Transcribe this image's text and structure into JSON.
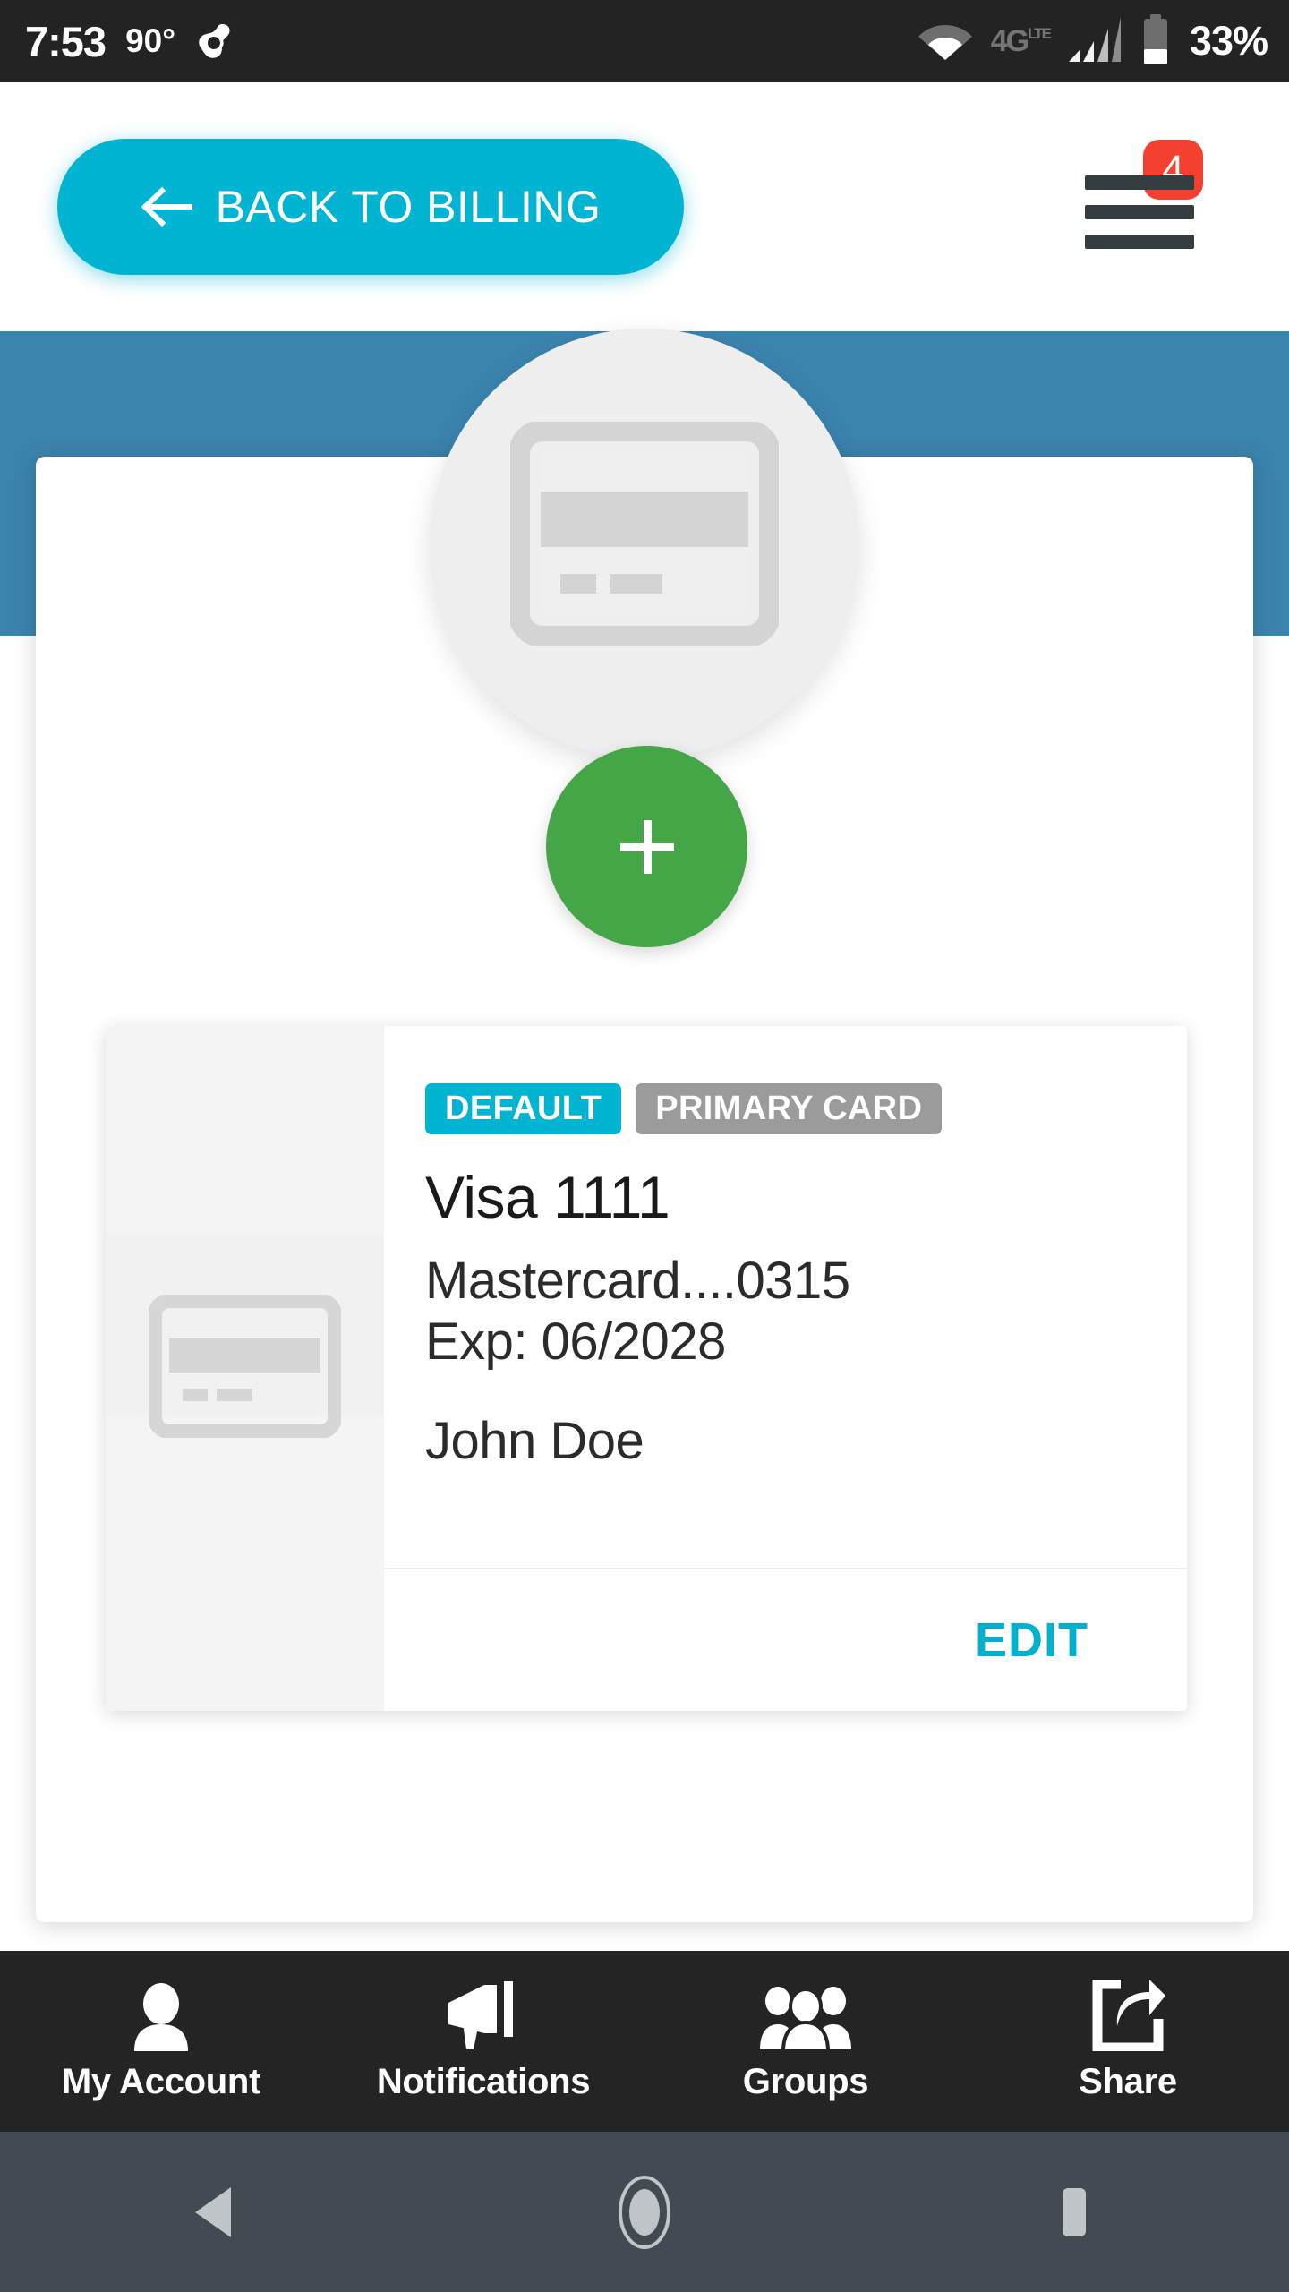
{
  "status_bar": {
    "time": "7:53",
    "temperature": "90°",
    "app_icon": "avast-shield-icon",
    "wifi_icon": "wifi-icon",
    "network_label": "4G",
    "network_sup": "LTE",
    "signal_icon": "cellular-signal-icon",
    "battery_icon": "battery-icon",
    "battery_text": "33%",
    "background": "#232323"
  },
  "header": {
    "back_button_label": "BACK TO BILLING",
    "back_icon": "arrow-left-icon",
    "menu_icon": "hamburger-menu-icon",
    "menu_badge_count": "4",
    "accent_color": "#00b4d2",
    "badge_color": "#f4402e"
  },
  "banner": {
    "background": "#3b84ae",
    "avatar_icon": "credit-card-icon"
  },
  "add_button": {
    "icon": "plus-icon",
    "label": "",
    "color": "#45a648"
  },
  "payment_method": {
    "thumbnail_icon": "credit-card-icon",
    "badges": [
      {
        "label": "DEFAULT",
        "color": "#00b4d2"
      },
      {
        "label": "PRIMARY CARD",
        "color": "#9b9b9b"
      }
    ],
    "title": "Visa 1111",
    "number_line": "Mastercard....0315",
    "expiry_line": "Exp: 06/2028",
    "cardholder": "John Doe",
    "edit_label": "EDIT",
    "edit_color": "#00b0cd"
  },
  "tab_bar": {
    "background": "#242424",
    "items": [
      {
        "label": "My Account",
        "icon": "person-icon"
      },
      {
        "label": "Notifications",
        "icon": "megaphone-icon"
      },
      {
        "label": "Groups",
        "icon": "people-group-icon"
      },
      {
        "label": "Share",
        "icon": "share-export-icon"
      }
    ]
  },
  "system_nav": {
    "background": "#434a52",
    "back_icon": "triangle-back-icon",
    "home_icon": "circle-home-icon",
    "recents_icon": "square-recents-icon"
  }
}
